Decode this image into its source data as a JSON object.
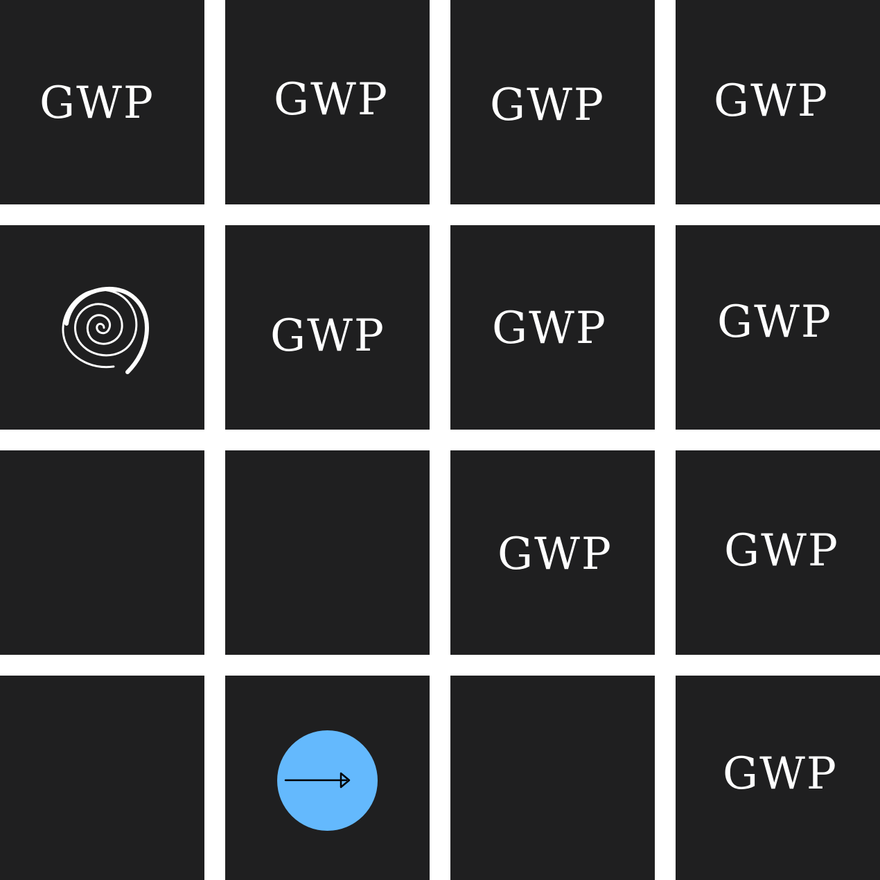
{
  "logo_text": "GWP",
  "colors": {
    "tile": "#1f1f20",
    "background": "#ffffff",
    "logo_text": "#ffffff",
    "button": "#64b9fd",
    "arrow": "#000000"
  },
  "icons": {
    "spiral": "spiral-icon",
    "arrow": "arrow-right-icon"
  }
}
